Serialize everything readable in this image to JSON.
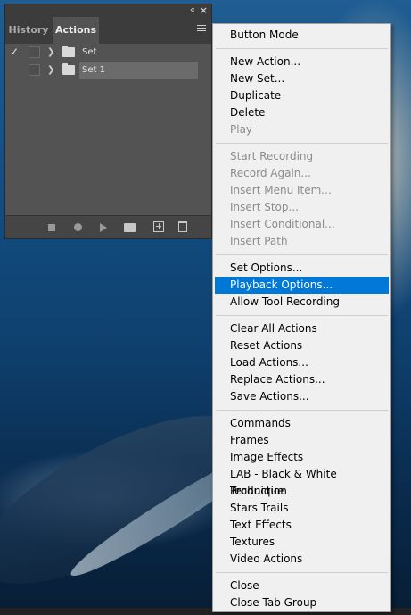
{
  "panel": {
    "tabs": [
      {
        "label": "History",
        "active": false
      },
      {
        "label": "Actions",
        "active": true
      }
    ],
    "rows": [
      {
        "label": "Set",
        "checked": true,
        "selected": false
      },
      {
        "label": "Set 1",
        "checked": false,
        "selected": true
      }
    ],
    "footer_icons": [
      "stop-icon",
      "record-icon",
      "play-icon",
      "new-set-icon",
      "new-action-icon",
      "delete-icon"
    ]
  },
  "menu": {
    "groups": [
      [
        {
          "label": "Button Mode",
          "enabled": true
        }
      ],
      [
        {
          "label": "New Action...",
          "enabled": true
        },
        {
          "label": "New Set...",
          "enabled": true
        },
        {
          "label": "Duplicate",
          "enabled": true
        },
        {
          "label": "Delete",
          "enabled": true
        },
        {
          "label": "Play",
          "enabled": false
        }
      ],
      [
        {
          "label": "Start Recording",
          "enabled": false
        },
        {
          "label": "Record Again...",
          "enabled": false
        },
        {
          "label": "Insert Menu Item...",
          "enabled": false
        },
        {
          "label": "Insert Stop...",
          "enabled": false
        },
        {
          "label": "Insert Conditional...",
          "enabled": false
        },
        {
          "label": "Insert Path",
          "enabled": false
        }
      ],
      [
        {
          "label": "Set Options...",
          "enabled": true
        },
        {
          "label": "Playback Options...",
          "enabled": true,
          "highlighted": true
        },
        {
          "label": "Allow Tool Recording",
          "enabled": true
        }
      ],
      [
        {
          "label": "Clear All Actions",
          "enabled": true
        },
        {
          "label": "Reset Actions",
          "enabled": true
        },
        {
          "label": "Load Actions...",
          "enabled": true
        },
        {
          "label": "Replace Actions...",
          "enabled": true
        },
        {
          "label": "Save Actions...",
          "enabled": true
        }
      ],
      [
        {
          "label": "Commands",
          "enabled": true
        },
        {
          "label": "Frames",
          "enabled": true
        },
        {
          "label": "Image Effects",
          "enabled": true
        },
        {
          "label": "LAB - Black & White Technique",
          "enabled": true
        },
        {
          "label": "Production",
          "enabled": true
        },
        {
          "label": "Stars Trails",
          "enabled": true
        },
        {
          "label": "Text Effects",
          "enabled": true
        },
        {
          "label": "Textures",
          "enabled": true
        },
        {
          "label": "Video Actions",
          "enabled": true
        }
      ],
      [
        {
          "label": "Close",
          "enabled": true
        },
        {
          "label": "Close Tab Group",
          "enabled": true
        }
      ]
    ],
    "colors": {
      "highlight": "#0078d7",
      "disabled": "#8c8c8c",
      "background": "#f0f0f0"
    }
  }
}
